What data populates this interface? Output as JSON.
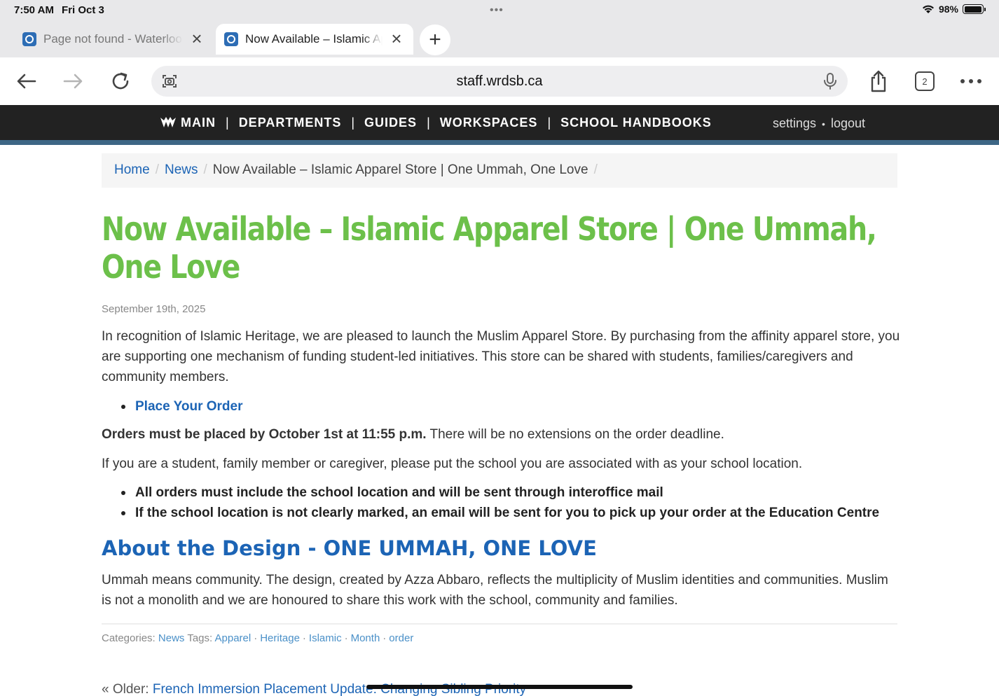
{
  "status_bar": {
    "time": "7:50 AM",
    "date": "Fri Oct 3",
    "battery": "98%",
    "battery_level": 0.98
  },
  "tabs": [
    {
      "title": "Page not found - Waterloo Region District School Board",
      "active": false
    },
    {
      "title": "Now Available – Islamic Apparel Store",
      "active": true
    }
  ],
  "toolbar": {
    "url": "staff.wrdsb.ca",
    "tab_count": "2"
  },
  "site_nav": {
    "items": [
      "MAIN",
      "DEPARTMENTS",
      "GUIDES",
      "WORKSPACES",
      "SCHOOL HANDBOOKS"
    ],
    "separator": "|",
    "settings": "settings",
    "dot": "•",
    "logout": "logout"
  },
  "breadcrumb": {
    "home": "Home",
    "news": "News",
    "current": "Now Available – Islamic Apparel Store | One Ummah, One Love",
    "separator": "/"
  },
  "article": {
    "title": "Now Available – Islamic Apparel Store | One Ummah, One Love",
    "date": "September 19th, 2025",
    "intro": "In recognition of Islamic Heritage, we are pleased to launch the Muslim Apparel Store. By purchasing from the affinity apparel store, you are supporting one mechanism of funding student-led initiatives. This store can be shared with students, families/caregivers and community members.",
    "order_link": "Place Your Order",
    "deadline_bold": "Orders must be placed by October 1st at 11:55 p.m.",
    "deadline_rest": " There will be no extensions on the order deadline.",
    "location_note": "If you are a student, family member or caregiver, please put the school you are associated with as your school location.",
    "bullets": [
      "All orders must include the school location and will be sent through interoffice mail",
      "If the school location is not clearly marked, an email will be sent for you to pick up your order at the Education Centre"
    ],
    "design_heading": "About the Design - ONE UMMAH, ONE LOVE",
    "design_text": "Ummah means community. The design, created by Azza Abbaro, reflects the multiplicity of Muslim identities and communities. Muslim is not a monolith and we are honoured to share this work with the school, community and families."
  },
  "meta": {
    "categories_label": "Categories:",
    "category": "News",
    "tags_label": "Tags:",
    "tags": [
      "Apparel",
      "Heritage",
      "Islamic",
      "Month",
      "order"
    ],
    "tag_separator": "·"
  },
  "pagination": {
    "older_label": "« Older:",
    "older_link": "French Immersion Placement Update: Changing Sibling Priority"
  },
  "colors": {
    "title_green": "#6cc04a",
    "link_blue": "#1c64b5",
    "nav_dark": "#222222",
    "nav_accent": "#3d6685"
  }
}
